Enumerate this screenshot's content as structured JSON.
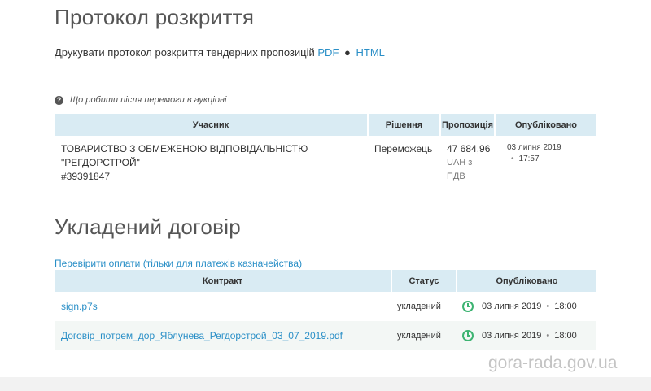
{
  "disclosure": {
    "title": "Протокол розкриття",
    "print_text": "Друкувати протокол розкриття тендерних пропозицій",
    "pdf_link": "PDF",
    "separator": "●",
    "html_link": "HTML",
    "help_icon": "question-circle-icon",
    "help_text": "Що робити після перемоги в аукціоні",
    "columns": [
      "Учасник",
      "Рішення",
      "Пропозиція",
      "Опубліковано"
    ],
    "rows": [
      {
        "participant_line1": "ТОВАРИСТВО З ОБМЕЖЕНОЮ ВІДПОВІДАЛЬНІСТЮ",
        "participant_line2": "\"РЕГДОРСТРОЙ\"",
        "participant_id": "#39391847",
        "decision": "Переможець",
        "amount": "47 684,96",
        "currency_line1": "UAH з",
        "currency_line2": "ПДВ",
        "date": "03 липня 2019",
        "time": "17:57"
      }
    ]
  },
  "contract": {
    "title": "Укладений договір",
    "check_payments_link": "Перевірити оплати (тільки для платежів казначейства)",
    "columns": [
      "Контракт",
      "Статус",
      "Опубліковано"
    ],
    "rows": [
      {
        "file": "sign.p7s",
        "status": "укладений",
        "date": "03 липня 2019",
        "time": "18:00",
        "icon": "clock-icon"
      },
      {
        "file": "Договір_потрем_дор_Яблунева_Регдорстрой_03_07_2019.pdf",
        "status": "укладений",
        "date": "03 липня 2019",
        "time": "18:00",
        "icon": "clock-icon"
      }
    ]
  },
  "watermark": "gora-rada.gov.ua",
  "colors": {
    "link": "#2a8fc7",
    "header_bg": "#d9ebf3",
    "clock": "#3cb371"
  }
}
